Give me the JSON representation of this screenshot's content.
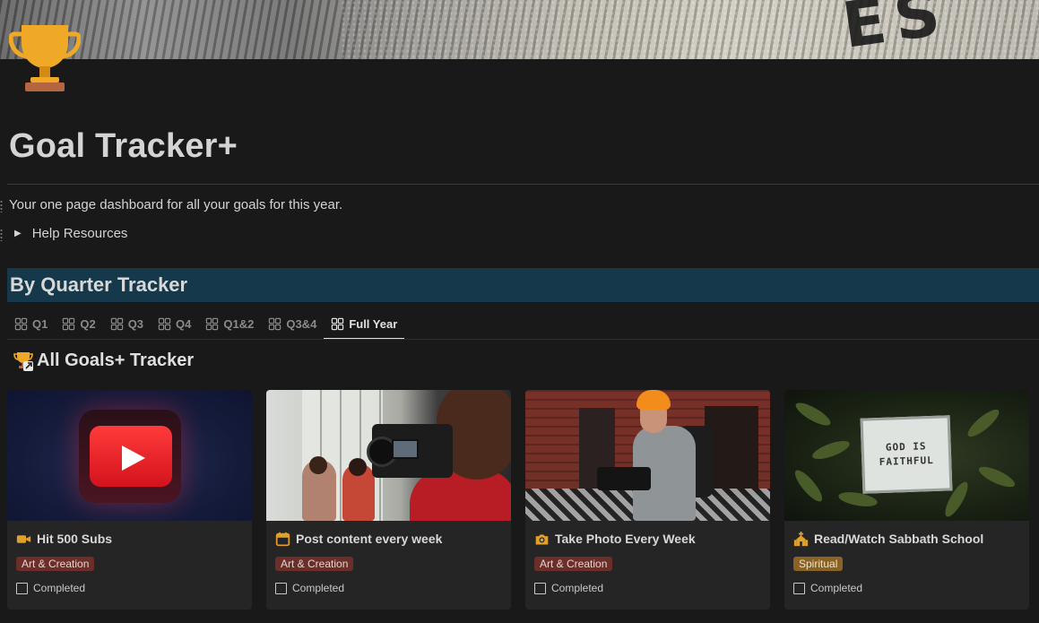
{
  "page": {
    "title": "Goal Tracker+",
    "subtitle": "Your one page dashboard for all your goals for this year.",
    "toggle_label": "Help Resources",
    "icon": "trophy-icon"
  },
  "cover": {
    "letters": "ES"
  },
  "quarter_section": {
    "heading": "By Quarter Tracker",
    "heading_bg": "#15394a",
    "tabs": [
      {
        "label": "Q1",
        "active": false
      },
      {
        "label": "Q2",
        "active": false
      },
      {
        "label": "Q3",
        "active": false
      },
      {
        "label": "Q4",
        "active": false
      },
      {
        "label": "Q1&2",
        "active": false
      },
      {
        "label": "Q3&4",
        "active": false
      },
      {
        "label": "Full Year",
        "active": true
      }
    ]
  },
  "goals_section": {
    "title": "All Goals+ Tracker",
    "icon": "trophy-link-icon",
    "cards": [
      {
        "name": "Hit 500 Subs",
        "icon": "video-camera-icon",
        "tag": "Art & Creation",
        "tag_color": "#6b2e29",
        "checkbox_label": "Completed",
        "checked": false
      },
      {
        "name": "Post content every week",
        "icon": "calendar-icon",
        "tag": "Art & Creation",
        "tag_color": "#6b2e29",
        "checkbox_label": "Completed",
        "checked": false
      },
      {
        "name": "Take Photo Every Week",
        "icon": "camera-icon",
        "tag": "Art & Creation",
        "tag_color": "#6b2e29",
        "checkbox_label": "Completed",
        "checked": false
      },
      {
        "name": "Read/Watch Sabbath School",
        "icon": "church-icon",
        "tag": "Spiritual",
        "tag_color": "#8a6224",
        "checkbox_label": "Completed",
        "checked": false
      }
    ],
    "card_images": {
      "board_line1": "GOD IS",
      "board_line2": "FAITHFUL"
    }
  },
  "colors": {
    "background": "#191919",
    "card": "#252525",
    "accent_icon": "#e0a02a"
  }
}
